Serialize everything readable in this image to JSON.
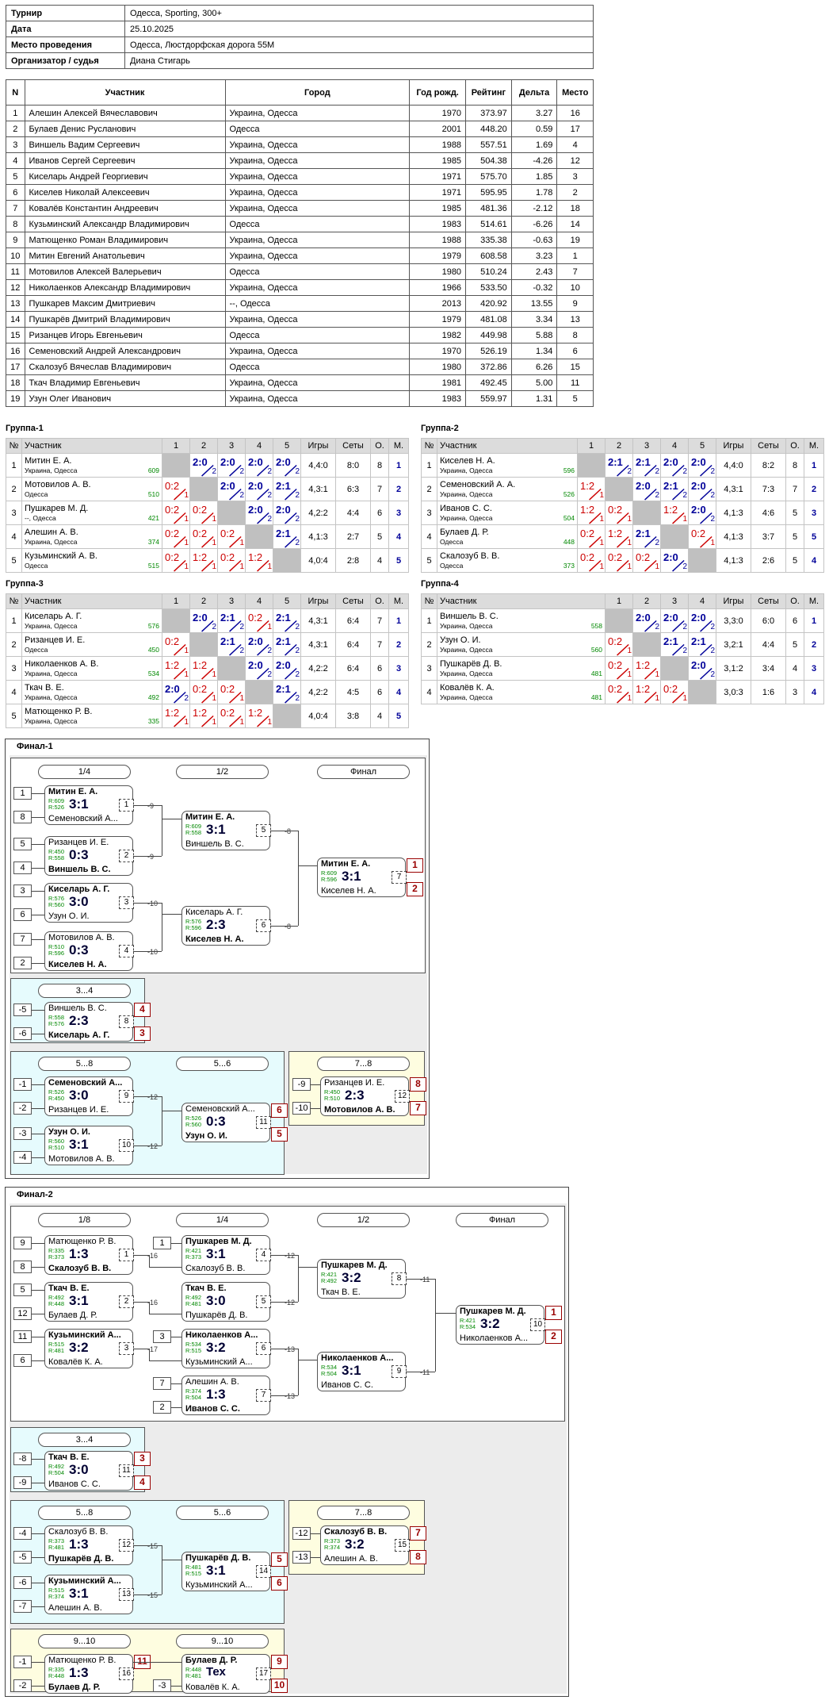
{
  "info": [
    {
      "k": "Турнир",
      "v": "Одесса, Sporting, 300+"
    },
    {
      "k": "Дата",
      "v": "25.10.2025"
    },
    {
      "k": "Место проведения",
      "v": "Одесса, Люстдорфская дорога 55М"
    },
    {
      "k": "Организатор / судья",
      "v": "Диана Стигарь"
    }
  ],
  "players_header": [
    "N",
    "Участник",
    "Город",
    "Год рожд.",
    "Рейтинг",
    "Дельта",
    "Место"
  ],
  "players": [
    [
      "1",
      "Алешин Алексей Вячеславович",
      "Украина, Одесса",
      "1970",
      "373.97",
      "3.27",
      "16"
    ],
    [
      "2",
      "Булаев Денис Русланович",
      "Одесса",
      "2001",
      "448.20",
      "0.59",
      "17"
    ],
    [
      "3",
      "Виншель Вадим Сергеевич",
      "Украина, Одесса",
      "1988",
      "557.51",
      "1.69",
      "4"
    ],
    [
      "4",
      "Иванов Сергей Сергеевич",
      "Украина, Одесса",
      "1985",
      "504.38",
      "-4.26",
      "12"
    ],
    [
      "5",
      "Киселарь Андрей Георгиевич",
      "Украина, Одесса",
      "1971",
      "575.70",
      "1.85",
      "3"
    ],
    [
      "6",
      "Киселев Николай Алексеевич",
      "Украина, Одесса",
      "1971",
      "595.95",
      "1.78",
      "2"
    ],
    [
      "7",
      "Ковалёв Константин Андреевич",
      "Украина, Одесса",
      "1985",
      "481.36",
      "-2.12",
      "18"
    ],
    [
      "8",
      "Кузьминский Александр Владимирович",
      "Одесса",
      "1983",
      "514.61",
      "-6.26",
      "14"
    ],
    [
      "9",
      "Матющенко Роман Владимирович",
      "Украина, Одесса",
      "1988",
      "335.38",
      "-0.63",
      "19"
    ],
    [
      "10",
      "Митин Евгений Анатольевич",
      "Украина, Одесса",
      "1979",
      "608.58",
      "3.23",
      "1"
    ],
    [
      "11",
      "Мотовилов Алексей Валерьевич",
      "Одесса",
      "1980",
      "510.24",
      "2.43",
      "7"
    ],
    [
      "12",
      "Николаенков Александр Владимирович",
      "Украина, Одесса",
      "1966",
      "533.50",
      "-0.32",
      "10"
    ],
    [
      "13",
      "Пушкарев Максим Дмитриевич",
      "--, Одесса",
      "2013",
      "420.92",
      "13.55",
      "9"
    ],
    [
      "14",
      "Пушкарёв Дмитрий Владимирович",
      "Украина, Одесса",
      "1979",
      "481.08",
      "3.34",
      "13"
    ],
    [
      "15",
      "Ризанцев Игорь Евгеньевич",
      "Одесса",
      "1982",
      "449.98",
      "5.88",
      "8"
    ],
    [
      "16",
      "Семеновский Андрей Александрович",
      "Украина, Одесса",
      "1970",
      "526.19",
      "1.34",
      "6"
    ],
    [
      "17",
      "Скалозуб Вячеслав Владимирович",
      "Одесса",
      "1980",
      "372.86",
      "6.26",
      "15"
    ],
    [
      "18",
      "Ткач Владимир Евгеньевич",
      "Украина, Одесса",
      "1981",
      "492.45",
      "5.00",
      "11"
    ],
    [
      "19",
      "Узун Олег Иванович",
      "Украина, Одесса",
      "1983",
      "559.97",
      "1.31",
      "5"
    ]
  ],
  "group_header": {
    "no": "№",
    "player": "Участник",
    "games": "Игры",
    "sets": "Сеты",
    "points": "О.",
    "place": "М."
  },
  "groups": [
    {
      "title": "Группа-1",
      "rows": [
        {
          "n": "1",
          "name": "Митин Е. А.",
          "city": "Украина, Одесса",
          "rt": "609",
          "sc": [
            null,
            "2:0",
            "2:0",
            "2:0",
            "2:0"
          ],
          "games": "4,4:0",
          "sets": "8:0",
          "pts": "8",
          "place": "1"
        },
        {
          "n": "2",
          "name": "Мотовилов А. В.",
          "city": "Одесса",
          "rt": "510",
          "sc": [
            "0:2",
            null,
            "2:0",
            "2:0",
            "2:1"
          ],
          "games": "4,3:1",
          "sets": "6:3",
          "pts": "7",
          "place": "2"
        },
        {
          "n": "3",
          "name": "Пушкарев М. Д.",
          "city": "--, Одесса",
          "rt": "421",
          "sc": [
            "0:2",
            "0:2",
            null,
            "2:0",
            "2:0"
          ],
          "games": "4,2:2",
          "sets": "4:4",
          "pts": "6",
          "place": "3"
        },
        {
          "n": "4",
          "name": "Алешин А. В.",
          "city": "Украина, Одесса",
          "rt": "374",
          "sc": [
            "0:2",
            "0:2",
            "0:2",
            null,
            "2:1"
          ],
          "games": "4,1:3",
          "sets": "2:7",
          "pts": "5",
          "place": "4"
        },
        {
          "n": "5",
          "name": "Кузьминский А. В.",
          "city": "Одесса",
          "rt": "515",
          "sc": [
            "0:2",
            "1:2",
            "0:2",
            "1:2",
            null
          ],
          "games": "4,0:4",
          "sets": "2:8",
          "pts": "4",
          "place": "5"
        }
      ]
    },
    {
      "title": "Группа-2",
      "rows": [
        {
          "n": "1",
          "name": "Киселев Н. А.",
          "city": "Украина, Одесса",
          "rt": "596",
          "sc": [
            null,
            "2:1",
            "2:1",
            "2:0",
            "2:0"
          ],
          "games": "4,4:0",
          "sets": "8:2",
          "pts": "8",
          "place": "1"
        },
        {
          "n": "2",
          "name": "Семеновский А. А.",
          "city": "Украина, Одесса",
          "rt": "526",
          "sc": [
            "1:2",
            null,
            "2:0",
            "2:1",
            "2:0"
          ],
          "games": "4,3:1",
          "sets": "7:3",
          "pts": "7",
          "place": "2"
        },
        {
          "n": "3",
          "name": "Иванов С. С.",
          "city": "Украина, Одесса",
          "rt": "504",
          "sc": [
            "1:2",
            "0:2",
            null,
            "1:2",
            "2:0"
          ],
          "games": "4,1:3",
          "sets": "4:6",
          "pts": "5",
          "place": "3"
        },
        {
          "n": "4",
          "name": "Булаев Д. Р.",
          "city": "Одесса",
          "rt": "448",
          "sc": [
            "0:2",
            "1:2",
            "2:1",
            null,
            "0:2"
          ],
          "games": "4,1:3",
          "sets": "3:7",
          "pts": "5",
          "place": "5"
        },
        {
          "n": "5",
          "name": "Скалозуб В. В.",
          "city": "Одесса",
          "rt": "373",
          "sc": [
            "0:2",
            "0:2",
            "0:2",
            "2:0",
            null
          ],
          "games": "4,1:3",
          "sets": "2:6",
          "pts": "5",
          "place": "4"
        }
      ]
    },
    {
      "title": "Группа-3",
      "rows": [
        {
          "n": "1",
          "name": "Киселарь А. Г.",
          "city": "Украина, Одесса",
          "rt": "576",
          "sc": [
            null,
            "2:0",
            "2:1",
            "0:2",
            "2:1"
          ],
          "games": "4,3:1",
          "sets": "6:4",
          "pts": "7",
          "place": "1"
        },
        {
          "n": "2",
          "name": "Ризанцев И. Е.",
          "city": "Одесса",
          "rt": "450",
          "sc": [
            "0:2",
            null,
            "2:1",
            "2:0",
            "2:1"
          ],
          "games": "4,3:1",
          "sets": "6:4",
          "pts": "7",
          "place": "2"
        },
        {
          "n": "3",
          "name": "Николаенков А. В.",
          "city": "Украина, Одесса",
          "rt": "534",
          "sc": [
            "1:2",
            "1:2",
            null,
            "2:0",
            "2:0"
          ],
          "games": "4,2:2",
          "sets": "6:4",
          "pts": "6",
          "place": "3"
        },
        {
          "n": "4",
          "name": "Ткач В. Е.",
          "city": "Украина, Одесса",
          "rt": "492",
          "sc": [
            "2:0",
            "0:2",
            "0:2",
            null,
            "2:1"
          ],
          "games": "4,2:2",
          "sets": "4:5",
          "pts": "6",
          "place": "4"
        },
        {
          "n": "5",
          "name": "Матющенко Р. В.",
          "city": "Украина, Одесса",
          "rt": "335",
          "sc": [
            "1:2",
            "1:2",
            "0:2",
            "1:2",
            null
          ],
          "games": "4,0:4",
          "sets": "3:8",
          "pts": "4",
          "place": "5"
        }
      ]
    },
    {
      "title": "Группа-4",
      "rows": [
        {
          "n": "1",
          "name": "Виншель В. С.",
          "city": "Украина, Одесса",
          "rt": "558",
          "sc": [
            null,
            "2:0",
            "2:0",
            "2:0"
          ],
          "games": "3,3:0",
          "sets": "6:0",
          "pts": "6",
          "place": "1"
        },
        {
          "n": "2",
          "name": "Узун О. И.",
          "city": "Украина, Одесса",
          "rt": "560",
          "sc": [
            "0:2",
            null,
            "2:1",
            "2:1"
          ],
          "games": "3,2:1",
          "sets": "4:4",
          "pts": "5",
          "place": "2"
        },
        {
          "n": "3",
          "name": "Пушкарёв Д. В.",
          "city": "Украина, Одесса",
          "rt": "481",
          "sc": [
            "0:2",
            "1:2",
            null,
            "2:0"
          ],
          "games": "3,1:2",
          "sets": "3:4",
          "pts": "4",
          "place": "3"
        },
        {
          "n": "4",
          "name": "Ковалёв К. А.",
          "city": "Украина, Одесса",
          "rt": "481",
          "sc": [
            "0:2",
            "1:2",
            "0:2",
            null
          ],
          "games": "3,0:3",
          "sets": "1:6",
          "pts": "3",
          "place": "4"
        }
      ]
    }
  ],
  "finals": [
    {
      "title": "Финал-1",
      "labels": [
        {
          "t": "1/4"
        },
        {
          "t": "1/2"
        },
        {
          "t": "Финал"
        },
        {
          "t": "3...4"
        },
        {
          "t": "5...8"
        },
        {
          "t": "5...6"
        },
        {
          "t": "7...8"
        }
      ],
      "matches": [
        {
          "top": "Митин Е. А.",
          "bot": "Семеновский А...",
          "w": "top",
          "r1": "R:609",
          "r2": "R:526",
          "score": "3:1",
          "mn": "1",
          "lnk": "-9",
          "s1": "1",
          "s2": "8"
        },
        {
          "top": "Ризанцев И. Е.",
          "bot": "Виншель В. С.",
          "w": "bot",
          "r1": "R:450",
          "r2": "R:558",
          "score": "0:3",
          "mn": "2",
          "lnk": "-9",
          "s1": "5",
          "s2": "4"
        },
        {
          "top": "Киселарь А. Г.",
          "bot": "Узун О. И.",
          "w": "top",
          "r1": "R:576",
          "r2": "R:560",
          "score": "3:0",
          "mn": "3",
          "lnk": "-10",
          "s1": "3",
          "s2": "6"
        },
        {
          "top": "Мотовилов А. В.",
          "bot": "Киселев Н. А.",
          "w": "bot",
          "r1": "R:510",
          "r2": "R:596",
          "score": "0:3",
          "mn": "4",
          "lnk": "-10",
          "s1": "7",
          "s2": "2"
        },
        {
          "top": "Митин Е. А.",
          "bot": "Виншель В. С.",
          "w": "top",
          "r1": "R:609",
          "r2": "R:558",
          "score": "3:1",
          "mn": "5",
          "lnk": "-8"
        },
        {
          "top": "Киселарь А. Г.",
          "bot": "Киселев Н. А.",
          "w": "bot",
          "r1": "R:576",
          "r2": "R:596",
          "score": "2:3",
          "mn": "6",
          "lnk": "-8"
        },
        {
          "top": "Митин Е. А.",
          "bot": "Киселев Н. А.",
          "w": "top",
          "r1": "R:609",
          "r2": "R:596",
          "score": "3:1",
          "mn": "7",
          "p1": "1",
          "p2": "2"
        },
        {
          "top": "Виншель В. С.",
          "bot": "Киселарь А. Г.",
          "w": "bot",
          "r1": "R:558",
          "r2": "R:576",
          "score": "2:3",
          "mn": "8",
          "p1": "4",
          "p2": "3",
          "s1": "-5",
          "s2": "-6"
        },
        {
          "top": "Семеновский А...",
          "bot": "Ризанцев И. Е.",
          "w": "top",
          "r1": "R:526",
          "r2": "R:450",
          "score": "3:0",
          "mn": "9",
          "lnk": "-12",
          "s1": "-1",
          "s2": "-2"
        },
        {
          "top": "Узун О. И.",
          "bot": "Мотовилов А. В.",
          "w": "top",
          "r1": "R:560",
          "r2": "R:510",
          "score": "3:1",
          "mn": "10",
          "lnk": "-12",
          "s1": "-3",
          "s2": "-4"
        },
        {
          "top": "Семеновский А...",
          "bot": "Узун О. И.",
          "w": "bot",
          "r1": "R:526",
          "r2": "R:560",
          "score": "0:3",
          "mn": "11",
          "p1": "6",
          "p2": "5"
        },
        {
          "top": "Ризанцев И. Е.",
          "bot": "Мотовилов А. В.",
          "w": "bot",
          "r1": "R:450",
          "r2": "R:510",
          "score": "2:3",
          "mn": "12",
          "p1": "8",
          "p2": "7",
          "s1": "-9",
          "s2": "-10"
        }
      ]
    },
    {
      "title": "Финал-2",
      "labels": [
        {
          "t": "1/8"
        },
        {
          "t": "1/4"
        },
        {
          "t": "1/2"
        },
        {
          "t": "Финал"
        },
        {
          "t": "3...4"
        },
        {
          "t": "5...8"
        },
        {
          "t": "5...6"
        },
        {
          "t": "7...8"
        },
        {
          "t": "9...10"
        },
        {
          "t": "9...10"
        }
      ],
      "matches": [
        {
          "top": "Матющенко Р. В.",
          "bot": "Скалозуб В. В.",
          "w": "bot",
          "r1": "R:335",
          "r2": "R:373",
          "score": "1:3",
          "mn": "1",
          "lnk": "-16",
          "s1": "9",
          "s2": "8"
        },
        {
          "top": "Ткач В. Е.",
          "bot": "Булаев Д. Р.",
          "w": "top",
          "r1": "R:492",
          "r2": "R:448",
          "score": "3:1",
          "mn": "2",
          "lnk": "-16",
          "s1": "5",
          "s2": "12"
        },
        {
          "top": "Кузьминский А...",
          "bot": "Ковалёв К. А.",
          "w": "top",
          "r1": "R:515",
          "r2": "R:481",
          "score": "3:2",
          "mn": "3",
          "lnk": "-17",
          "s1": "11",
          "s2": "6"
        },
        {
          "top": "Пушкарев М. Д.",
          "bot": "Скалозуб В. В.",
          "w": "top",
          "r1": "R:421",
          "r2": "R:373",
          "score": "3:1",
          "mn": "4",
          "lnk": "-12",
          "s1": "1"
        },
        {
          "top": "Ткач В. Е.",
          "bot": "Пушкарёв Д. В.",
          "w": "top",
          "r1": "R:492",
          "r2": "R:481",
          "score": "3:0",
          "mn": "5",
          "lnk": "-12"
        },
        {
          "top": "Николаенков А...",
          "bot": "Кузьминский А...",
          "w": "top",
          "r1": "R:534",
          "r2": "R:515",
          "score": "3:2",
          "mn": "6",
          "lnk": "-13",
          "s1": "3"
        },
        {
          "top": "Алешин А. В.",
          "bot": "Иванов С. С.",
          "w": "bot",
          "r1": "R:374",
          "r2": "R:504",
          "score": "1:3",
          "mn": "7",
          "lnk": "-13",
          "s1": "7",
          "s2": "2"
        },
        {
          "top": "Пушкарев М. Д.",
          "bot": "Ткач В. Е.",
          "w": "top",
          "r1": "R:421",
          "r2": "R:492",
          "score": "3:2",
          "mn": "8",
          "lnk": "-11"
        },
        {
          "top": "Николаенков А...",
          "bot": "Иванов С. С.",
          "w": "top",
          "r1": "R:534",
          "r2": "R:504",
          "score": "3:1",
          "mn": "9",
          "lnk": "-11"
        },
        {
          "top": "Пушкарев М. Д.",
          "bot": "Николаенков А...",
          "w": "top",
          "r1": "R:421",
          "r2": "R:534",
          "score": "3:2",
          "mn": "10",
          "p1": "1",
          "p2": "2"
        },
        {
          "top": "Ткач В. Е.",
          "bot": "Иванов С. С.",
          "w": "top",
          "r1": "R:492",
          "r2": "R:504",
          "score": "3:0",
          "mn": "11",
          "p1": "3",
          "p2": "4",
          "s1": "-8",
          "s2": "-9"
        },
        {
          "top": "Скалозуб В. В.",
          "bot": "Пушкарёв Д. В.",
          "w": "bot",
          "r1": "R:373",
          "r2": "R:481",
          "score": "1:3",
          "mn": "12",
          "lnk": "-15",
          "s1": "-4",
          "s2": "-5"
        },
        {
          "top": "Кузьминский А...",
          "bot": "Алешин А. В.",
          "w": "top",
          "r1": "R:515",
          "r2": "R:374",
          "score": "3:1",
          "mn": "13",
          "lnk": "-15",
          "s1": "-6",
          "s2": "-7"
        },
        {
          "top": "Пушкарёв Д. В.",
          "bot": "Кузьминский А...",
          "w": "top",
          "r1": "R:481",
          "r2": "R:515",
          "score": "3:1",
          "mn": "14",
          "p1": "5",
          "p2": "6"
        },
        {
          "top": "Скалозуб В. В.",
          "bot": "Алешин А. В.",
          "w": "top",
          "r1": "R:373",
          "r2": "R:374",
          "score": "3:2",
          "mn": "15",
          "p1": "7",
          "p2": "8",
          "s1": "-12",
          "s2": "-13"
        },
        {
          "top": "Матющенко Р. В.",
          "bot": "Булаев Д. Р.",
          "w": "bot",
          "r1": "R:335",
          "r2": "R:448",
          "score": "1:3",
          "mn": "16",
          "p1": "11",
          "s1": "-1",
          "s2": "-2"
        },
        {
          "top": "Булаев Д. Р.",
          "bot": "Ковалёв К. А.",
          "w": "top",
          "r1": "R:448",
          "r2": "R:481",
          "score": "Тех",
          "mn": "17",
          "p1": "9",
          "p2": "10",
          "s2": "-3"
        }
      ]
    }
  ]
}
